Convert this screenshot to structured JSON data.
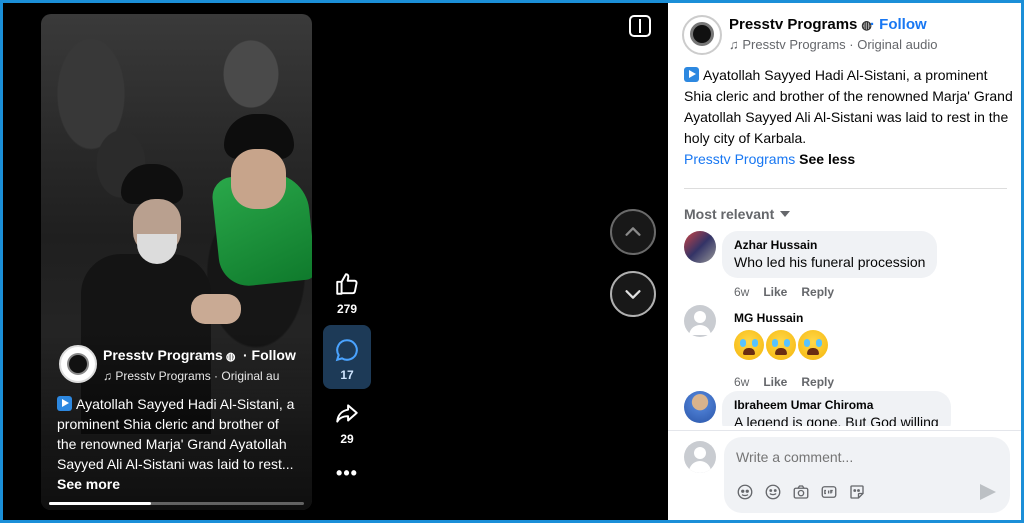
{
  "video": {
    "page_name": "Presstv Programs",
    "follow_label": "· Follow",
    "audio_label": "♫ Presstv Programs · Original au",
    "caption": "Ayatollah Sayyed Hadi Al-Sistani, a prominent Shia cleric and brother of the renowned Marja' Grand Ayatollah Sayyed Ali Al-Sistani was laid to rest...",
    "see_more": "See more",
    "progress": 0.4
  },
  "actions": {
    "likes": "279",
    "comments": "17",
    "shares": "29",
    "more": "•••"
  },
  "post": {
    "page_name": "Presstv Programs",
    "follow_label": "· Follow",
    "audio_label": "♫ Presstv Programs · Original audio",
    "text": "Ayatollah Sayyed Hadi Al-Sistani, a prominent Shia cleric and brother of the renowned Marja' Grand Ayatollah Sayyed Ali Al-Sistani was laid to rest in the holy city of Karbala.",
    "tag_link": "Presstv Programs",
    "see_less": "See less"
  },
  "comments": {
    "sort_label": "Most relevant",
    "items": [
      {
        "author": "Azhar Hussain",
        "text": "Who led his funeral procession",
        "age": "6w",
        "like": "Like",
        "reply": "Reply"
      },
      {
        "author": "MG Hussain",
        "age": "6w",
        "like": "Like",
        "reply": "Reply"
      },
      {
        "author": "Ibraheem Umar Chiroma",
        "text": "A legend is gone. But God willing"
      }
    ]
  },
  "composer": {
    "placeholder": "Write a comment..."
  },
  "colors": {
    "accent": "#1877f2",
    "frame_border": "#1b8fd8",
    "comment_active_bg": "#1d3a57"
  }
}
